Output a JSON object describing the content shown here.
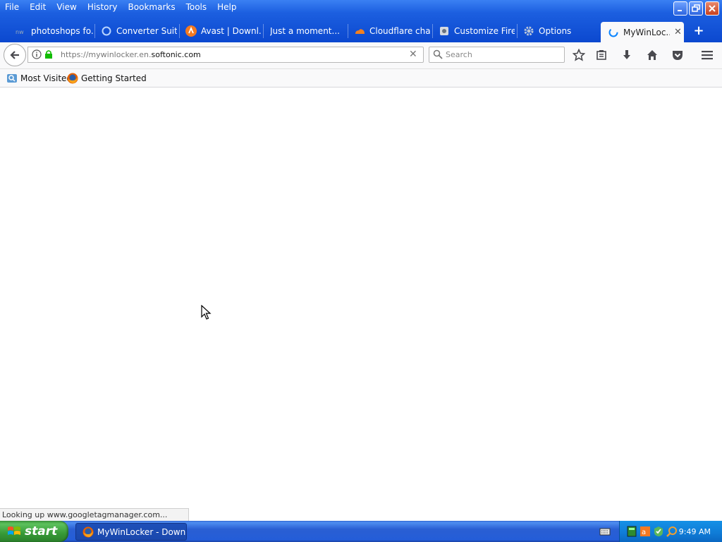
{
  "menu": [
    "File",
    "Edit",
    "View",
    "History",
    "Bookmarks",
    "Tools",
    "Help"
  ],
  "tabs": [
    {
      "label": "photoshops fo...",
      "icon": "site-icon"
    },
    {
      "label": "Converter Suit...",
      "icon": "converter-icon"
    },
    {
      "label": "Avast | Downl...",
      "icon": "avast-icon"
    },
    {
      "label": "Just a moment...",
      "icon": ""
    },
    {
      "label": "Cloudflare cha...",
      "icon": "cloudflare-icon"
    },
    {
      "label": "Customize Fire...",
      "icon": "customize-icon"
    },
    {
      "label": "Options",
      "icon": "gear-icon"
    }
  ],
  "active_tab": {
    "label": "MyWinLoc...",
    "icon": "loading-icon"
  },
  "url": {
    "prefix": "https://mywinlocker.en.",
    "domain": "softonic.com"
  },
  "search": {
    "placeholder": "Search"
  },
  "bookmarks": [
    {
      "label": "Most Visited",
      "icon": "most-visited-icon"
    },
    {
      "label": "Getting Started",
      "icon": "firefox-icon"
    }
  ],
  "status_text": "Looking up www.googletagmanager.com...",
  "taskbar": {
    "start_label": "start",
    "task_label": "MyWinLocker - Downl...",
    "clock": "9:49 AM"
  },
  "colors": {
    "xp_blue": "#245dd8",
    "start_green": "#3c9a3c",
    "toolbar_bg": "#f9f9fa"
  }
}
